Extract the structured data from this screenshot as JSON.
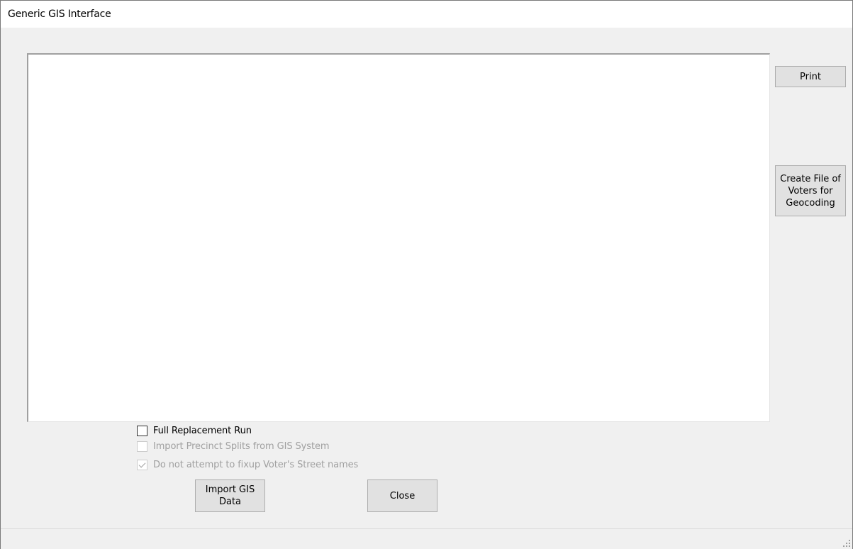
{
  "window": {
    "title": "Generic GIS Interface"
  },
  "buttons": {
    "print": "Print",
    "create_file": "Create File of\nVoters for\nGeocoding",
    "import_gis": "Import GIS\nData",
    "close": "Close"
  },
  "options": {
    "full_replacement": {
      "label": "Full Replacement Run",
      "checked": false,
      "enabled": true
    },
    "import_splits": {
      "label": "Import Precinct Splits from GIS System",
      "checked": false,
      "enabled": false
    },
    "no_fixup": {
      "label": "Do not attempt to fixup Voter's Street names",
      "checked": true,
      "enabled": false
    }
  },
  "icons": {
    "resize_grip": "resize-grip-icon",
    "checkmark": "checkmark-icon"
  }
}
